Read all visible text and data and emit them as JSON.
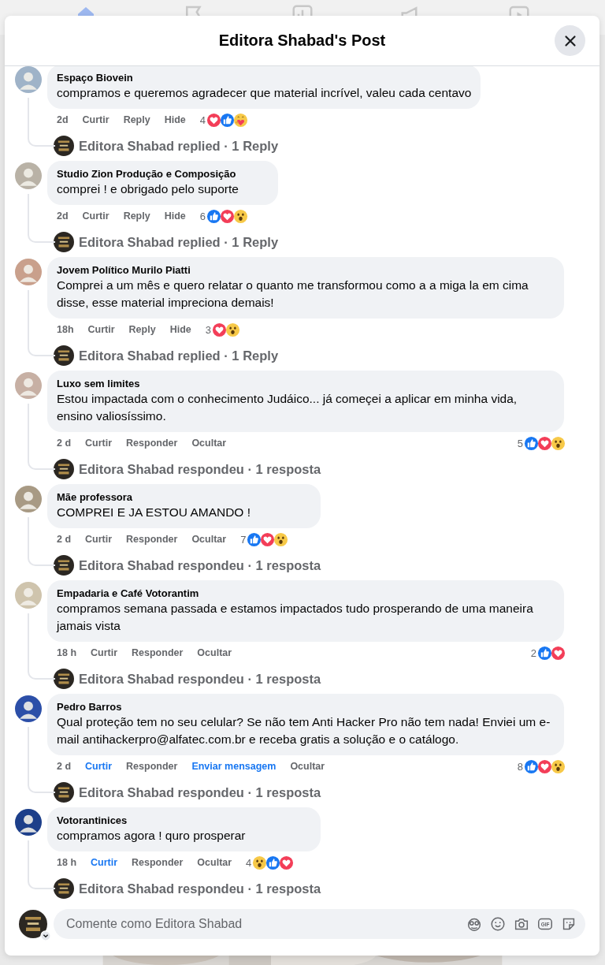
{
  "modal": {
    "title": "Editora Shabad's Post"
  },
  "comments": [
    {
      "author": "Espaço Biovein",
      "text": "compramos e queremos agradecer que material incrível, valeu cada centavo",
      "time": "2d",
      "actions": [
        {
          "label": "Curtir",
          "active": false
        },
        {
          "label": "Reply",
          "active": false
        },
        {
          "label": "Hide",
          "active": false
        }
      ],
      "reaction_count": "4",
      "reactions": [
        {
          "kind": "love"
        },
        {
          "kind": "like"
        },
        {
          "kind": "care"
        }
      ],
      "reactions_at_end": false,
      "reply_summary": "Editora Shabad replied · 1 Reply"
    },
    {
      "author": "Studio Zion Produção e Composição",
      "text": "comprei ! e obrigado pelo suporte",
      "time": "2d",
      "actions": [
        {
          "label": "Curtir",
          "active": false
        },
        {
          "label": "Reply",
          "active": false
        },
        {
          "label": "Hide",
          "active": false
        }
      ],
      "reaction_count": "6",
      "reactions": [
        {
          "kind": "like"
        },
        {
          "kind": "love"
        },
        {
          "kind": "wow"
        }
      ],
      "reactions_at_end": false,
      "reply_summary": "Editora Shabad replied · 1 Reply"
    },
    {
      "author": "Jovem Político Murilo Piatti",
      "text": "Comprei a um mês e quero relatar o quanto me transformou como a a miga la em cima disse, esse material impreciona demais!",
      "time": "18h",
      "actions": [
        {
          "label": "Curtir",
          "active": false
        },
        {
          "label": "Reply",
          "active": false
        },
        {
          "label": "Hide",
          "active": false
        }
      ],
      "reaction_count": "3",
      "reactions": [
        {
          "kind": "love"
        },
        {
          "kind": "wow"
        }
      ],
      "reactions_at_end": false,
      "reply_summary": "Editora Shabad replied · 1 Reply"
    },
    {
      "author": "Luxo sem limites",
      "text": "Estou impactada com o conhecimento Judáico... já começei a aplicar em minha vida, ensino valiosíssimo.",
      "time": "2 d",
      "actions": [
        {
          "label": "Curtir",
          "active": false
        },
        {
          "label": "Responder",
          "active": false
        },
        {
          "label": "Ocultar",
          "active": false
        }
      ],
      "reaction_count": "5",
      "reactions": [
        {
          "kind": "like"
        },
        {
          "kind": "love"
        },
        {
          "kind": "wow"
        }
      ],
      "reactions_at_end": true,
      "reply_summary": "Editora Shabad respondeu · 1 resposta"
    },
    {
      "author": "Mãe professora",
      "text": "COMPREI E JA ESTOU AMANDO !",
      "time": "2 d",
      "actions": [
        {
          "label": "Curtir",
          "active": false
        },
        {
          "label": "Responder",
          "active": false
        },
        {
          "label": "Ocultar",
          "active": false
        }
      ],
      "reaction_count": "7",
      "reactions": [
        {
          "kind": "like"
        },
        {
          "kind": "love"
        },
        {
          "kind": "wow"
        }
      ],
      "reactions_at_end": false,
      "reply_summary": "Editora Shabad respondeu · 1 resposta"
    },
    {
      "author": "Empadaria e Café Votorantim",
      "text": "compramos semana passada e estamos impactados tudo prosperando de uma maneira jamais vista",
      "time": "18 h",
      "actions": [
        {
          "label": "Curtir",
          "active": false
        },
        {
          "label": "Responder",
          "active": false
        },
        {
          "label": "Ocultar",
          "active": false
        }
      ],
      "reaction_count": "2",
      "reactions": [
        {
          "kind": "like"
        },
        {
          "kind": "love"
        }
      ],
      "reactions_at_end": true,
      "reply_summary": "Editora Shabad respondeu · 1 resposta"
    },
    {
      "author": "Pedro Barros",
      "text": "Qual proteção tem no seu celular? Se não tem Anti Hacker Pro não tem nada! Enviei um e-mail antihackerpro@alfatec.com.br e receba gratis a solução e o catálogo.",
      "time": "2 d",
      "actions": [
        {
          "label": "Curtir",
          "active": true
        },
        {
          "label": "Responder",
          "active": false
        },
        {
          "label": "Enviar mensagem",
          "active": true
        },
        {
          "label": "Ocultar",
          "active": false
        }
      ],
      "reaction_count": "8",
      "reactions": [
        {
          "kind": "like"
        },
        {
          "kind": "love"
        },
        {
          "kind": "wow"
        }
      ],
      "reactions_at_end": true,
      "reply_summary": "Editora Shabad respondeu · 1 resposta"
    },
    {
      "author": "Votorantinices",
      "text": "compramos agora ! quro prosperar",
      "time": "18 h",
      "actions": [
        {
          "label": "Curtir",
          "active": true
        },
        {
          "label": "Responder",
          "active": false
        },
        {
          "label": "Ocultar",
          "active": false
        }
      ],
      "reaction_count": "4",
      "reactions": [
        {
          "kind": "wow"
        },
        {
          "kind": "like"
        },
        {
          "kind": "love"
        }
      ],
      "reactions_at_end": false,
      "reply_summary": "Editora Shabad respondeu · 1 resposta"
    }
  ],
  "composer": {
    "placeholder": "Comente como Editora Shabad",
    "gif_label": "GIF"
  }
}
